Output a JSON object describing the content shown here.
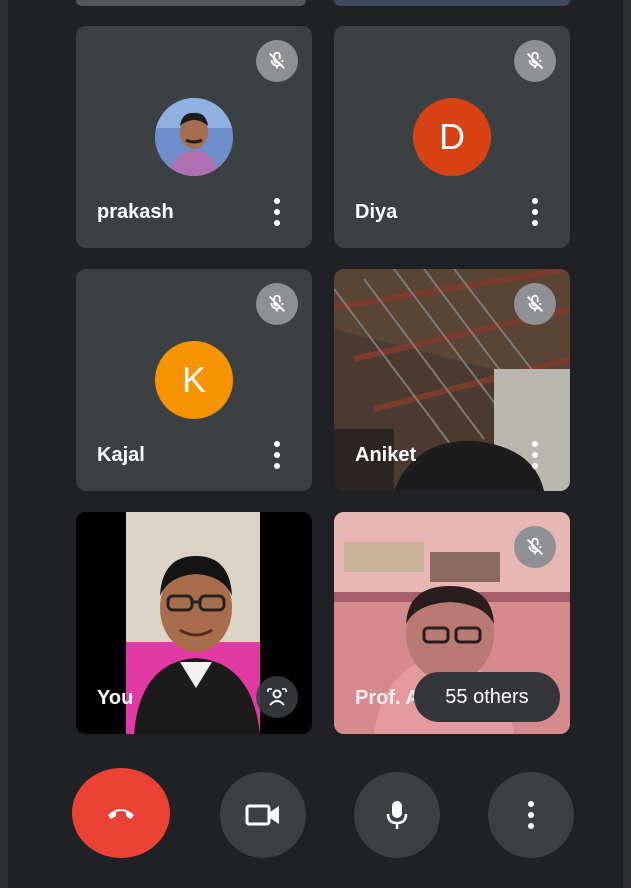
{
  "participants": [
    {
      "name": "prakash",
      "avatar_type": "photo",
      "muted": true
    },
    {
      "name": "Diya",
      "avatar_initial": "D",
      "avatar_color": "#d84315",
      "muted": true
    },
    {
      "name": "Kajal",
      "avatar_initial": "K",
      "avatar_color": "#f59300",
      "muted": true
    },
    {
      "name": "Aniket",
      "avatar_type": "video",
      "muted": true
    },
    {
      "name": "You",
      "avatar_type": "video",
      "muted": false
    },
    {
      "name": "Prof. A",
      "avatar_type": "video",
      "muted": true
    }
  ],
  "others_label": "55 others",
  "controls": {
    "end_call": "end-call",
    "camera": "camera",
    "microphone": "microphone",
    "more": "more-options"
  },
  "colors": {
    "background": "#202124",
    "tile": "#3c4043",
    "end_call": "#ea4335"
  }
}
